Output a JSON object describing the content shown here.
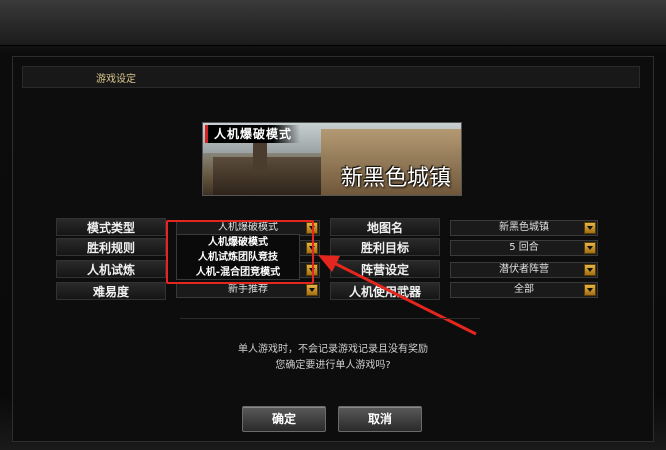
{
  "dialog": {
    "title": "游戏设定"
  },
  "banner": {
    "mode_tag": "人机爆破模式",
    "map_name": "新黑色城镇"
  },
  "left": {
    "mode_type": {
      "label": "模式类型",
      "value": "人机爆破模式"
    },
    "win_rule": {
      "label": "胜利规则"
    },
    "bot_trial": {
      "label": "人机试炼"
    },
    "difficulty": {
      "label": "难易度",
      "value": "新手推荐"
    }
  },
  "right": {
    "map_name": {
      "label": "地图名",
      "value": "新黑色城镇"
    },
    "win_target": {
      "label": "胜利目标",
      "value": "5 回合"
    },
    "camp": {
      "label": "阵营设定",
      "value": "潜伏者阵营"
    },
    "bot_weapon": {
      "label": "人机使用武器",
      "value": "全部"
    }
  },
  "dropdown": {
    "options": [
      "人机爆破模式",
      "人机试炼团队竞技",
      "人机-混合团竞模式"
    ]
  },
  "notice": {
    "line1": "单人游戏时，不会记录游戏记录且没有奖励",
    "line2": "您确定要进行单人游戏吗?"
  },
  "buttons": {
    "confirm": "确定",
    "cancel": "取消"
  },
  "colors": {
    "highlight": "#e5261e",
    "accent": "#d9c48a",
    "arrow": "#e3b447"
  }
}
